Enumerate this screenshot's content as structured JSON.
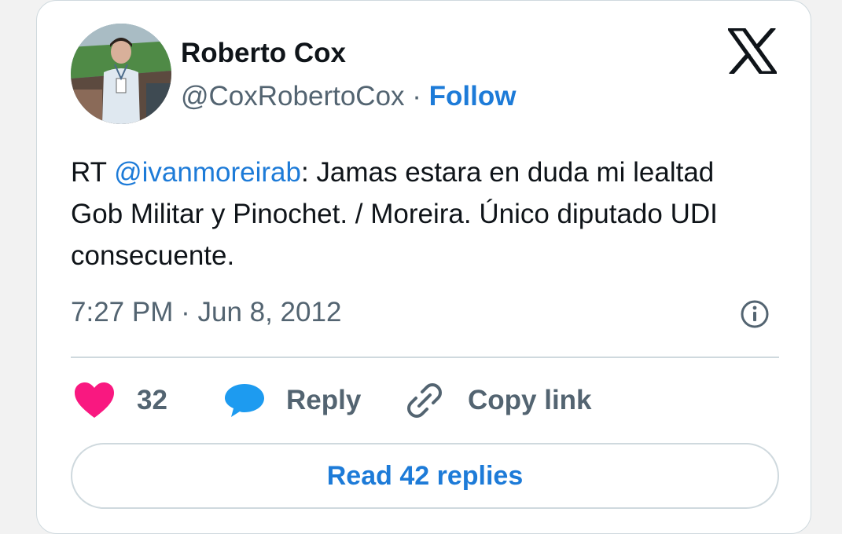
{
  "author": {
    "display_name": "Roberto Cox",
    "handle": "@CoxRobertoCox",
    "separator": "·",
    "follow_label": "Follow"
  },
  "tweet": {
    "prefix": "RT ",
    "mention": "@ivanmoreirab",
    "body": ": Jamas estara en duda mi lealtad Gob Militar y  Pinochet. / Moreira. Único diputado UDI consecuente.",
    "time": "7:27 PM",
    "separator": "·",
    "date": "Jun 8, 2012"
  },
  "actions": {
    "like_count": "32",
    "reply_label": "Reply",
    "copy_label": "Copy link"
  },
  "read_replies_label": "Read 42 replies",
  "icons": {
    "like": "heart-icon",
    "reply": "speech-bubble-icon",
    "copy": "link-icon",
    "info": "info-icon",
    "brand": "x-logo-icon"
  },
  "colors": {
    "accent": "#1d7bd8",
    "like": "#f91880",
    "text": "#0f1419",
    "muted": "#536471",
    "border": "#cfd9de"
  }
}
